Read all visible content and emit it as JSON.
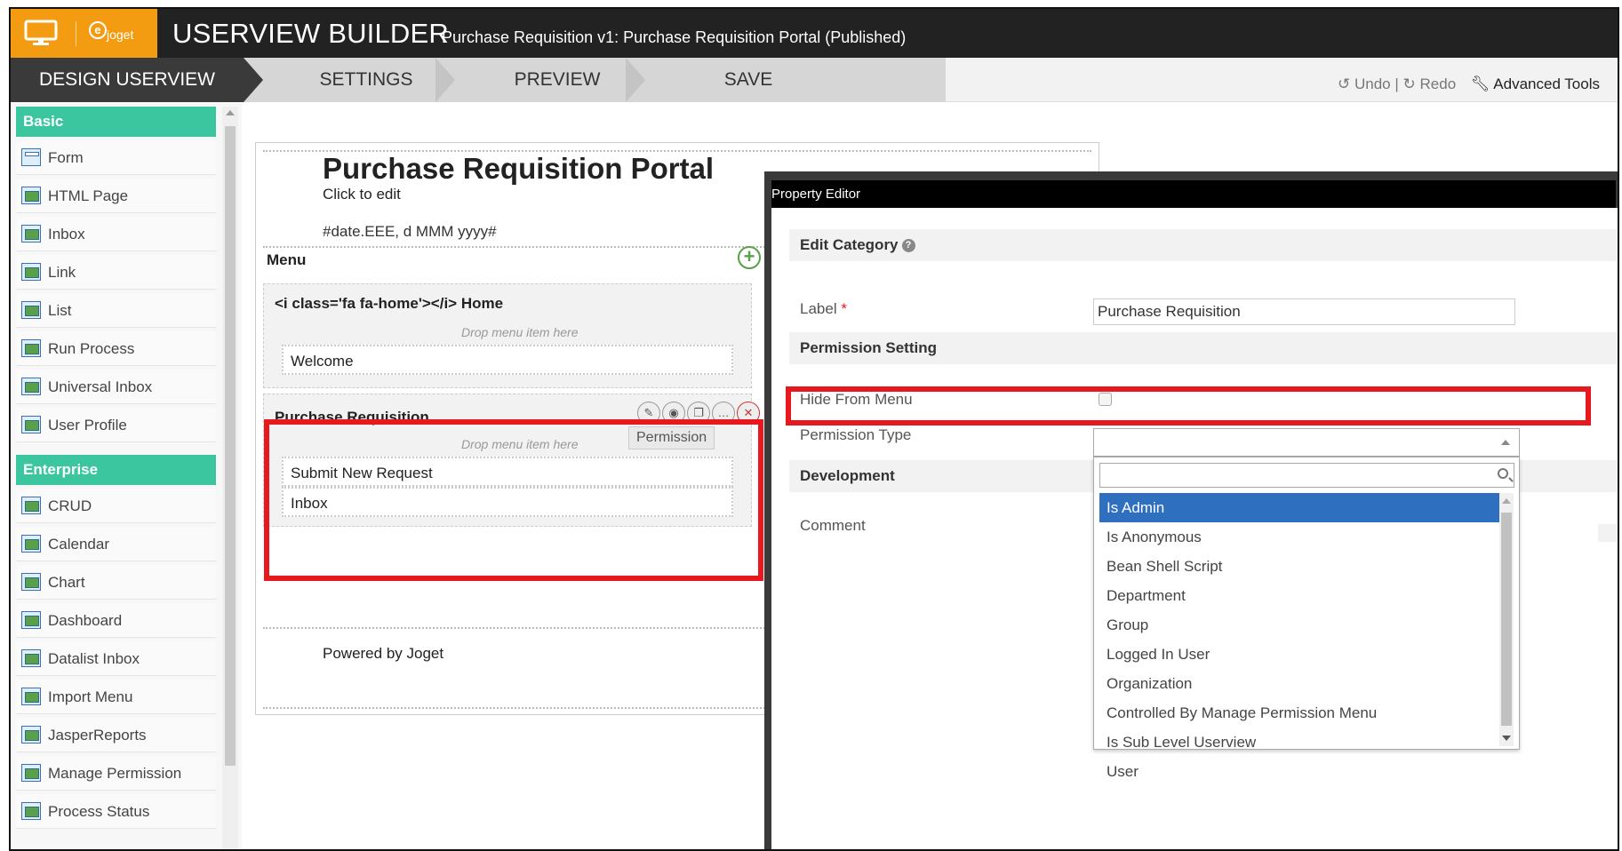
{
  "topbar": {
    "brand": "joget",
    "brand_mark": "e",
    "title": "USERVIEW BUILDER",
    "subtitle": "Purchase Requisition v1: Purchase Requisition Portal (Published)"
  },
  "nav": {
    "steps": [
      "DESIGN USERVIEW",
      "SETTINGS",
      "PREVIEW",
      "SAVE"
    ],
    "undo": "Undo",
    "separator": "|",
    "redo": "Redo",
    "advanced_tools": "Advanced Tools"
  },
  "palette": {
    "basic_header": "Basic",
    "basic_items": [
      "Form",
      "HTML Page",
      "Inbox",
      "Link",
      "List",
      "Run Process",
      "Universal Inbox",
      "User Profile"
    ],
    "enterprise_header": "Enterprise",
    "enterprise_items": [
      "CRUD",
      "Calendar",
      "Chart",
      "Dashboard",
      "Datalist Inbox",
      "Import Menu",
      "JasperReports",
      "Manage Permission",
      "Process Status"
    ]
  },
  "canvas": {
    "portal_title": "Purchase Requisition Portal",
    "click_to_edit": "Click to edit",
    "date_format": "#date.EEE, d MMM yyyy#",
    "menu_label": "Menu",
    "categories": [
      {
        "title": "<i class='fa fa-home'></i> Home",
        "drop_hint": "Drop menu item here",
        "items": [
          "Welcome"
        ]
      },
      {
        "title": "Purchase Requisition",
        "drop_hint": "Drop menu item here",
        "items": [
          "Submit New Request",
          "Inbox"
        ]
      }
    ],
    "tooltip": "Permission",
    "footer": "Powered by Joget"
  },
  "property_editor": {
    "header": "Property Editor",
    "section_edit": "Edit Category",
    "label_field_label": "Label",
    "required_mark": "*",
    "label_value": "Purchase Requisition",
    "section_permission": "Permission Setting",
    "hide_from_menu_label": "Hide From Menu",
    "permission_type_label": "Permission Type",
    "section_development": "Development",
    "comment_label": "Comment",
    "permission_options": [
      "Is Admin",
      "Is Anonymous",
      "Bean Shell Script",
      "Department",
      "Group",
      "Logged In User",
      "Organization",
      "Controlled By Manage Permission Menu",
      "Is Sub Level Userview",
      "User"
    ],
    "selected_option": "Is Admin"
  },
  "colors": {
    "accent_orange": "#f39c12",
    "palette_header": "#3bc6a0",
    "highlight_red": "#e8191e",
    "selected_blue": "#2f6fbf"
  }
}
